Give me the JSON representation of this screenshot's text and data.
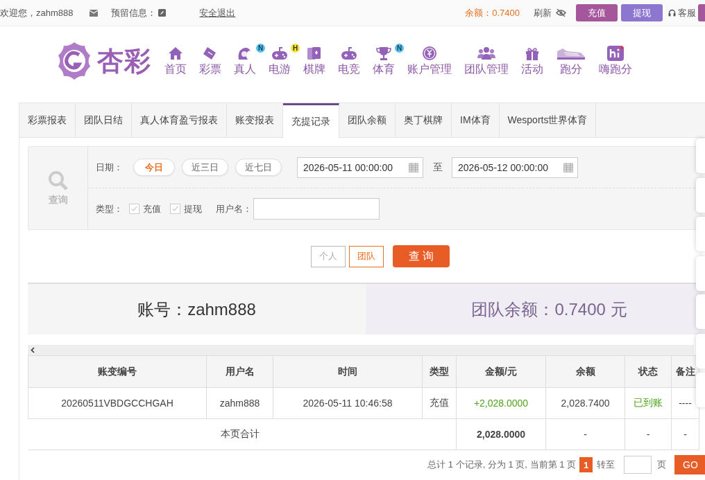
{
  "top_bar": {
    "greeting": "欢迎您，zahm888",
    "message_label": "预留信息：",
    "logout": "安全退出",
    "balance": "余额：0.7400",
    "refresh": "刷新",
    "deposit": "充值",
    "withdraw": "提现",
    "support": "客服"
  },
  "header": {
    "logo": "杏彩",
    "nav": [
      {
        "label": "首页",
        "kind": "home"
      },
      {
        "label": "彩票",
        "kind": "ticket"
      },
      {
        "label": "真人",
        "kind": "lady",
        "badge": "N",
        "color": "#4fc3f7"
      },
      {
        "label": "电游",
        "kind": "gamepad",
        "badge": "H",
        "color": "#f5e43a"
      },
      {
        "label": "棋牌",
        "kind": "cards"
      },
      {
        "label": "电竞",
        "kind": "gamepad"
      },
      {
        "label": "体育",
        "kind": "trophy",
        "badge": "N",
        "color": "#4fc3f7"
      },
      {
        "label": "账户管理",
        "kind": "coin"
      },
      {
        "label": "团队管理",
        "kind": "people"
      },
      {
        "label": "活动",
        "kind": "gift"
      },
      {
        "label": "跑分",
        "kind": "shoe"
      },
      {
        "label": "嗨跑分",
        "kind": "app"
      }
    ]
  },
  "tabs": [
    {
      "label": "彩票报表",
      "selected": false
    },
    {
      "label": "团队日结",
      "selected": false
    },
    {
      "label": "真人体育盈亏报表",
      "selected": false
    },
    {
      "label": "账变报表",
      "selected": false
    },
    {
      "label": "充提记录",
      "selected": true
    },
    {
      "label": "团队余额",
      "selected": false
    },
    {
      "label": "奥丁棋牌",
      "selected": false
    },
    {
      "label": "IM体育",
      "selected": false
    },
    {
      "label": "Wesports世界体育",
      "selected": false
    }
  ],
  "filter": {
    "search_label": "查询",
    "date_label": "日期：",
    "presets": [
      {
        "label": "今日",
        "selected": true
      },
      {
        "label": "近三日",
        "selected": false
      },
      {
        "label": "近七日",
        "selected": false
      }
    ],
    "start_date": "2026-05-11 00:00:00",
    "separator": "至",
    "end_date": "2026-05-12 00:00:00",
    "type_label": "类型：",
    "types": [
      {
        "label": "充值",
        "checked": true
      },
      {
        "label": "提现",
        "checked": true
      }
    ],
    "username_label": "用户名："
  },
  "scope_buttons": [
    {
      "label": "个人",
      "selected": false
    },
    {
      "label": "团队",
      "selected": true
    }
  ],
  "query_button": "查 询",
  "summary": {
    "account": "账号：zahm888",
    "team_balance": "团队余额：0.7400 元"
  },
  "table": {
    "columns": [
      "账变编号",
      "用户名",
      "时间",
      "类型",
      "金额/元",
      "余额",
      "状态",
      "备注"
    ],
    "rows": [
      {
        "cells": [
          "20260511VBDGCCHGAH",
          "zahm888",
          "2026-05-11 10:46:58",
          "充值",
          "+2,028.0000",
          "2,028.7400",
          "已到账",
          "----"
        ]
      }
    ],
    "total": {
      "label": "本页合计",
      "amount": "2,028.0000",
      "balance": "-",
      "status": "-",
      "note": "-"
    }
  },
  "pagination": {
    "info": "总计 1 个记录, 分为 1 页, 当前第 1 页",
    "current": "1",
    "goto": "转至",
    "page_unit": "页",
    "go": "GO"
  }
}
